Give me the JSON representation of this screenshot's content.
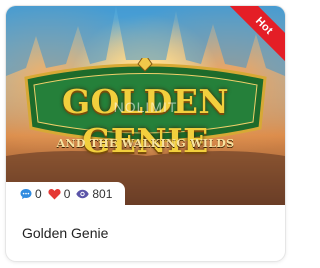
{
  "card": {
    "badge": "Hot",
    "thumbnail": {
      "logo_title": "GOLDEN GENIE",
      "logo_subtitle": "AND THE WALKING WILDS",
      "watermark": "NOLIMIT"
    },
    "stats": {
      "comments": "0",
      "likes": "0",
      "views": "801",
      "icons": [
        "comment-icon",
        "heart-icon",
        "eye-icon"
      ]
    },
    "title": "Golden Genie"
  },
  "colors": {
    "hot_ribbon": "#e41e26",
    "comment_icon": "#2f8be0",
    "heart_icon": "#e53935",
    "eye_icon": "#5b54a8"
  }
}
